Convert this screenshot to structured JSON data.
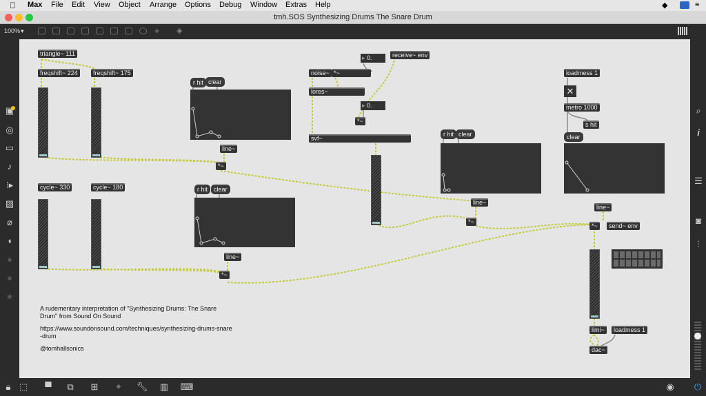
{
  "menubar": {
    "app": "Max",
    "items": [
      "File",
      "Edit",
      "View",
      "Object",
      "Arrange",
      "Options",
      "Debug",
      "Window",
      "Extras",
      "Help"
    ]
  },
  "window": {
    "title": "tmh.SOS Synthesizing Drums The Snare Drum"
  },
  "toolbar": {
    "zoom": "100%"
  },
  "objects": {
    "triangle": "triangle~ 111",
    "freqshift1": "freqshift~ 224",
    "freqshift2": "freqshift~ 175",
    "cycle1": "cycle~ 330",
    "cycle2": "cycle~ 180",
    "noise": "noise~",
    "mult_noise": "*~",
    "lores": "lores~",
    "svf": "svf~",
    "receive": "receive~ env",
    "mult_svf": "*~",
    "loadmess1": "loadmess 1",
    "metro": "metro 1000",
    "s_hit": "s hit",
    "line1": "line~",
    "mult1": "*~",
    "line2": "line~",
    "mult2": "*~",
    "line3": "line~",
    "mult3": "*~",
    "line4": "line~",
    "mult4": "*~",
    "send_env": "send~ env",
    "limi": "limi~",
    "loadmess2": "loadmess 1",
    "dac": "dac~"
  },
  "messages": {
    "rhit1": "r hit",
    "clear1": "clear",
    "rhit2": "r hit",
    "clear2": "clear",
    "rhit3": "r hit",
    "clear3": "clear",
    "clear4": "clear"
  },
  "numbers": {
    "num1": "0.",
    "num2": "0."
  },
  "comment": {
    "description": "A rudementary interpretation of \"Synthesizing Drums: The Snare Drum\" from Sound On Sound",
    "url": "https://www.soundonsound.com/techniques/synthesizing-drums-snare-drum",
    "author": "@tomhallsonics"
  },
  "colors": {
    "canvas": "#e5e5e5",
    "object": "#333333",
    "patchcord_signal": "#b7c63a"
  }
}
